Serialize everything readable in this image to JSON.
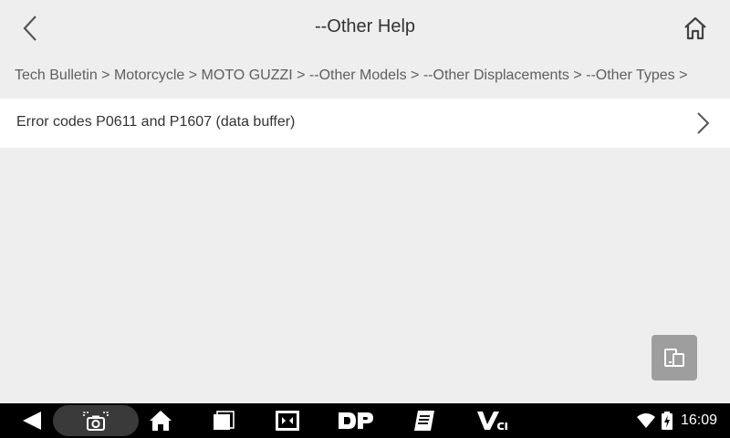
{
  "header": {
    "title": "--Other Help",
    "back_icon": "chevron-left-icon",
    "home_icon": "home-icon"
  },
  "breadcrumb": {
    "text": "Tech Bulletin > Motorcycle > MOTO GUZZI > --Other Models > --Other Displacements > --Other Types >"
  },
  "list": {
    "items": [
      {
        "label": "Error codes P0611 and P1607 (data buffer)",
        "icon": "chevron-right-icon"
      }
    ]
  },
  "floating_button": {
    "icon": "device-switch-icon"
  },
  "navbar": {
    "icons": [
      "back-triangle-icon",
      "screenshot-icon",
      "home-icon",
      "recent-apps-icon",
      "display-icon",
      "dp-icon",
      "manual-icon",
      "vci-icon"
    ],
    "vci_label": "VCI",
    "dp_label": "DP"
  },
  "status": {
    "time": "16:09",
    "icons": [
      "wifi-icon",
      "battery-charging-icon"
    ]
  },
  "colors": {
    "background": "#eeeeee",
    "list_item_bg": "#ffffff",
    "navbar_bg": "#000000",
    "floating_button_bg": "#9e9e9e"
  }
}
